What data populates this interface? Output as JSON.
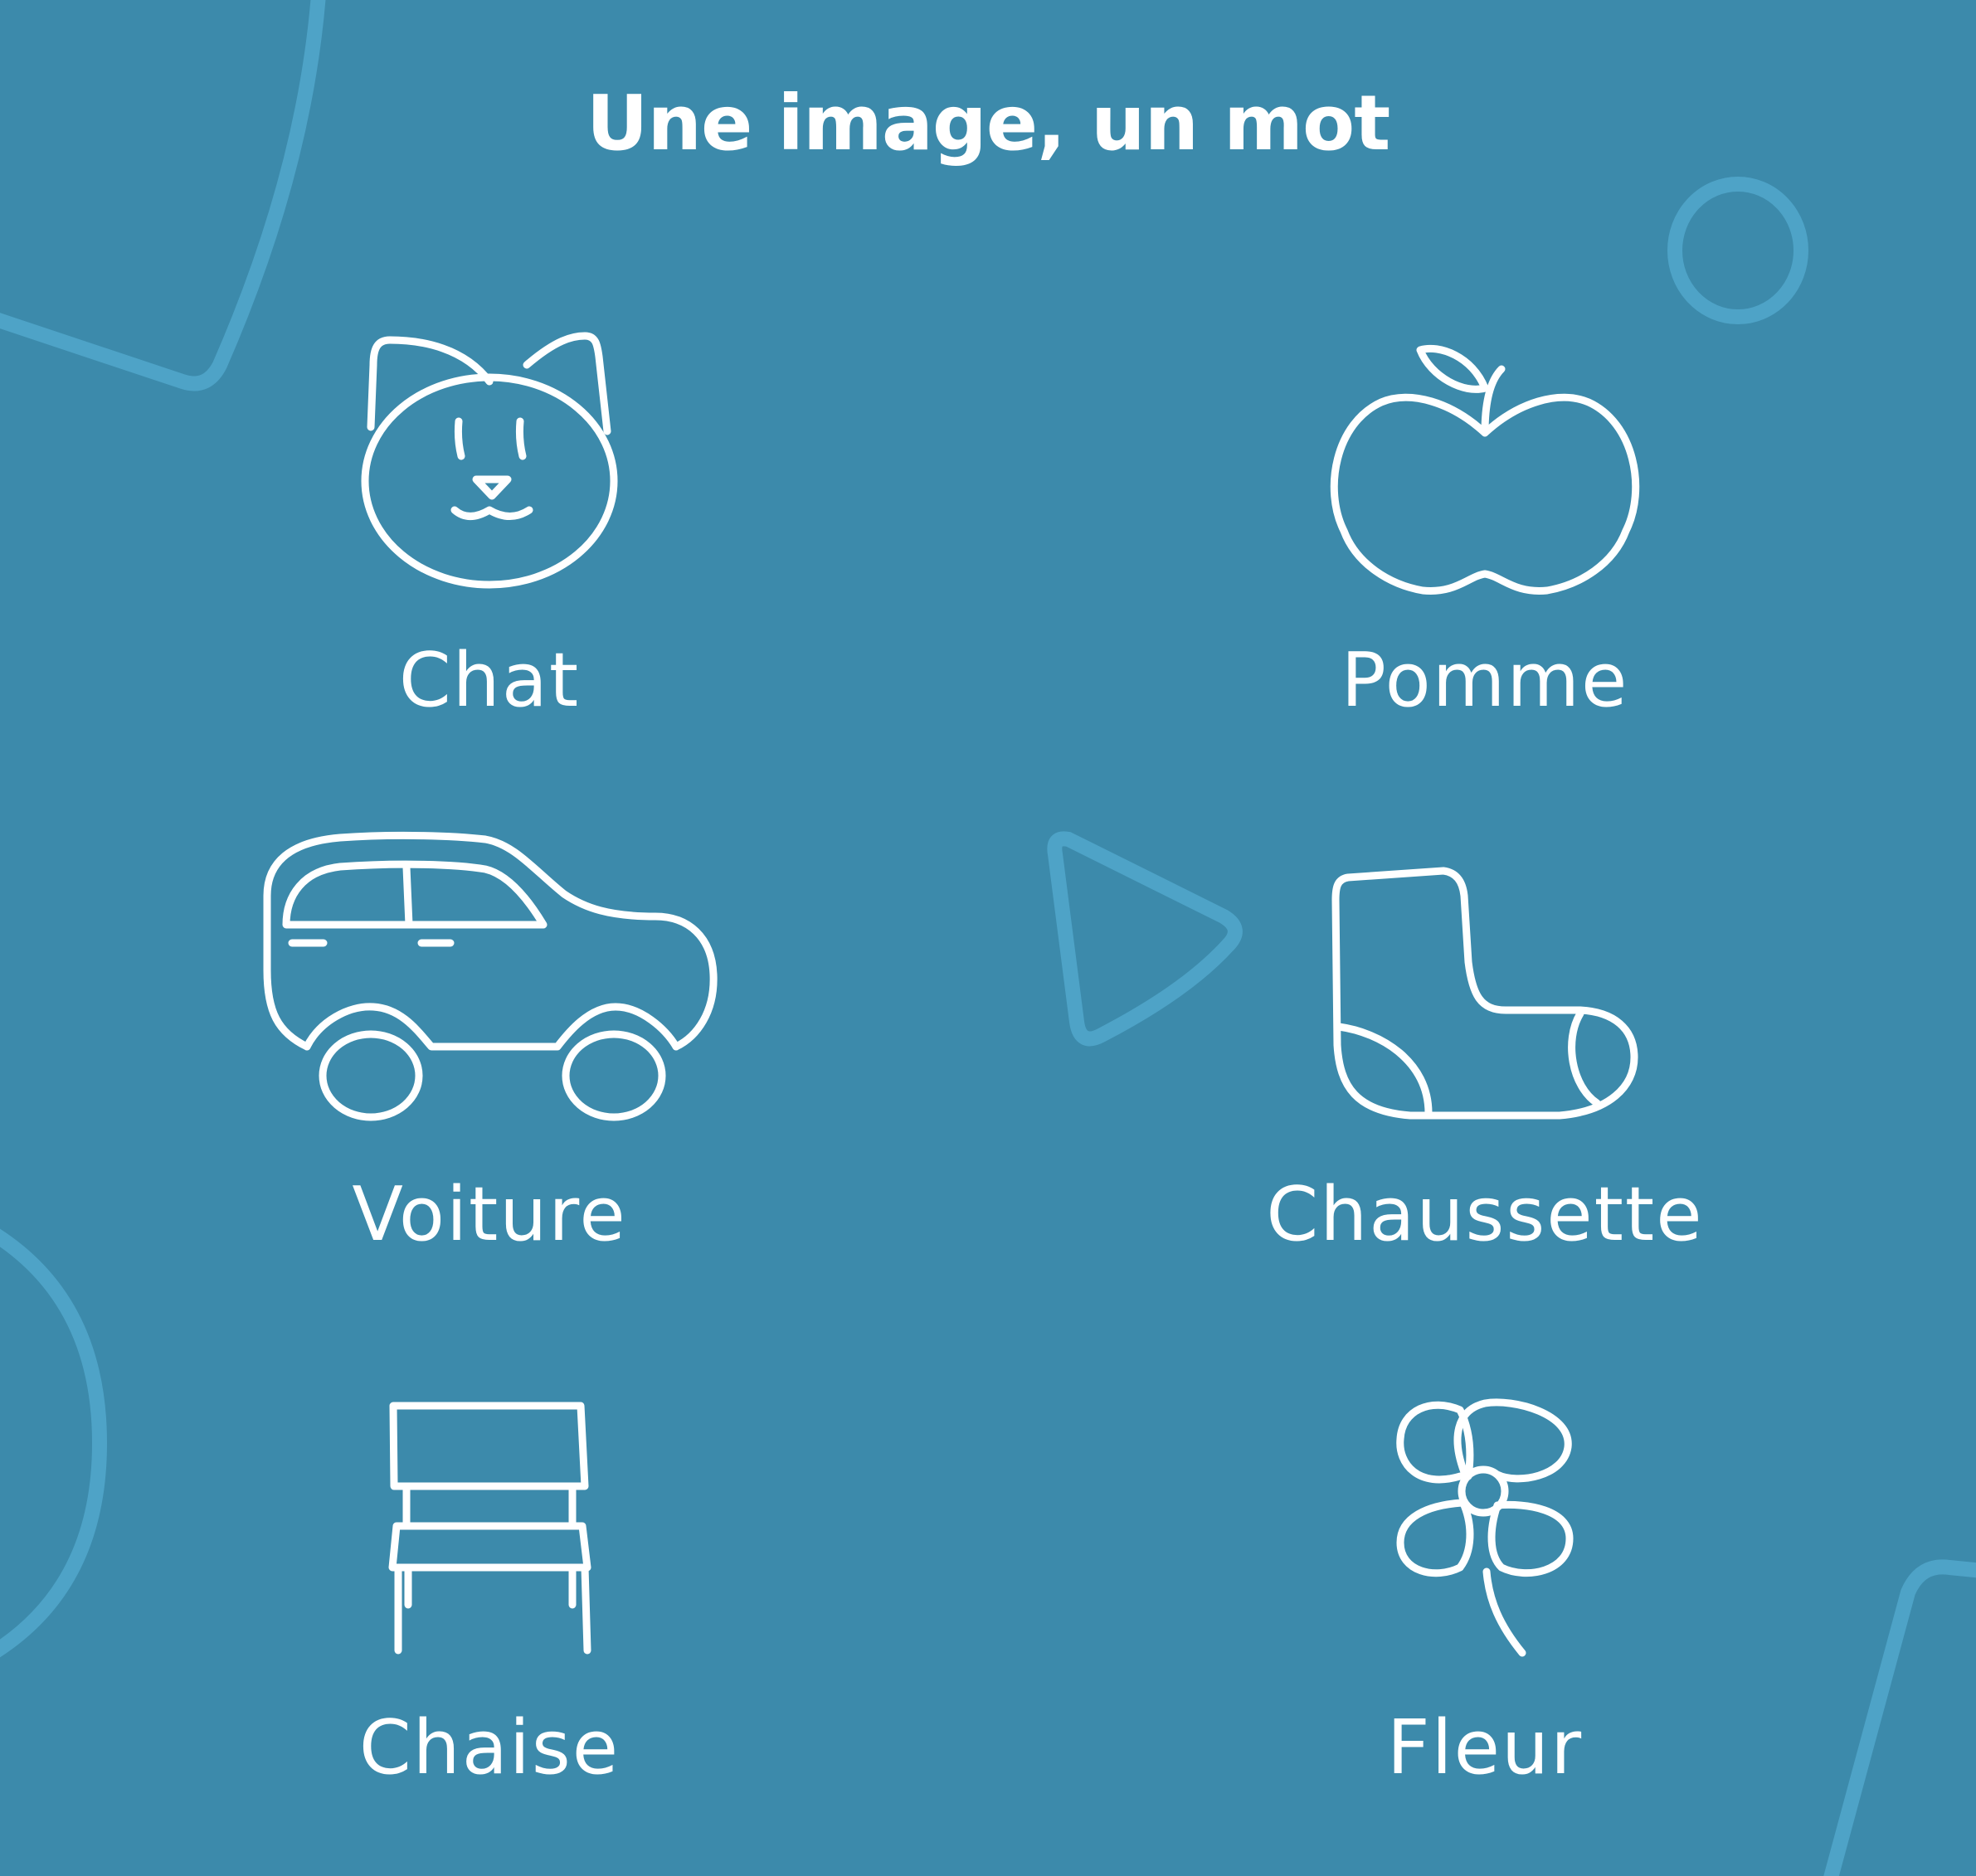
{
  "title": "Une image, un mot",
  "items": [
    {
      "label": "Chat",
      "icon": "cat-icon"
    },
    {
      "label": "Pomme",
      "icon": "apple-icon"
    },
    {
      "label": "Voiture",
      "icon": "car-icon"
    },
    {
      "label": "Chaussette",
      "icon": "sock-icon"
    },
    {
      "label": "Chaise",
      "icon": "chair-icon"
    },
    {
      "label": "Fleur",
      "icon": "flower-icon"
    }
  ],
  "colors": {
    "background": "#3c8aab",
    "foreground": "#ffffff",
    "decoration": "#4ea3c7"
  }
}
